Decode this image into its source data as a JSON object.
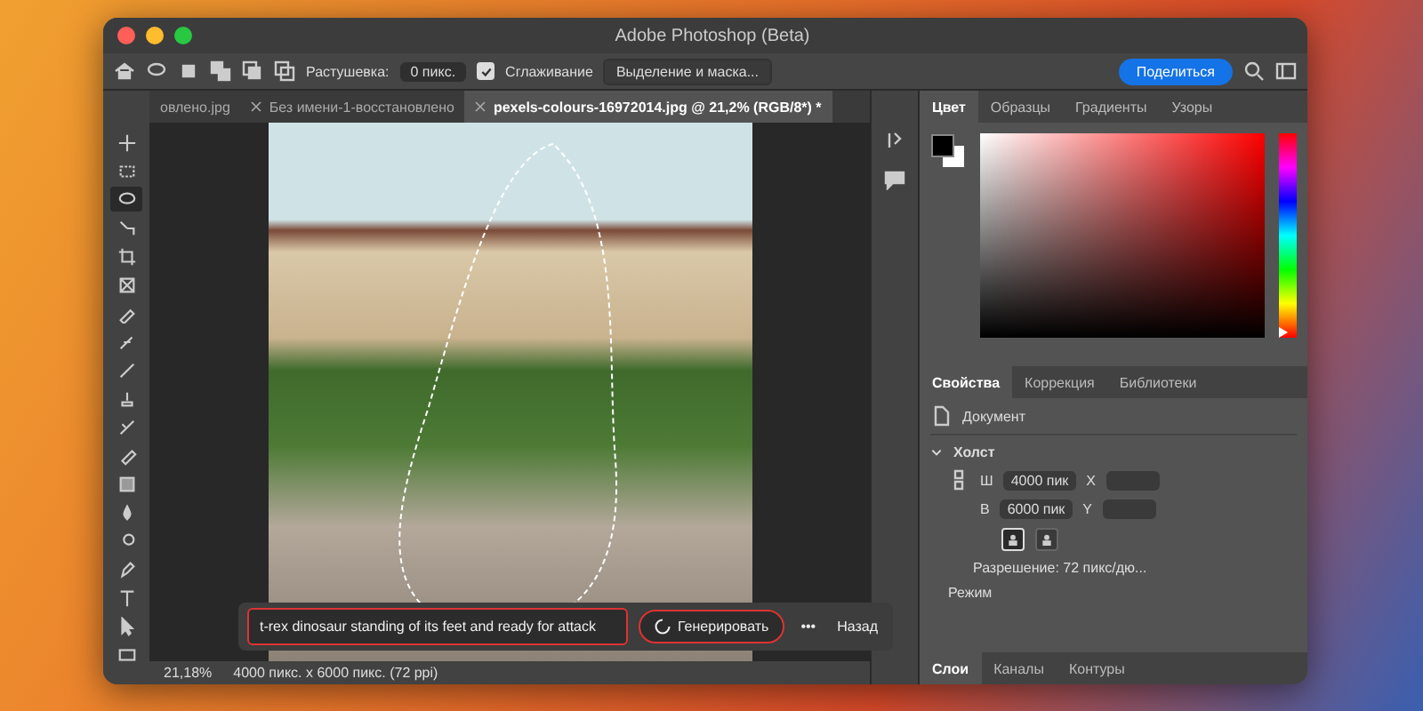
{
  "window": {
    "title": "Adobe Photoshop (Beta)"
  },
  "options_bar": {
    "feather_label": "Растушевка:",
    "feather_value": "0 пикс.",
    "antialias": {
      "label": "Сглаживание",
      "checked": true
    },
    "select_mask_button": "Выделение и маска...",
    "share_button": "Поделиться"
  },
  "doc_tabs": [
    {
      "label": "овлено.jpg",
      "selected": false
    },
    {
      "label": "Без имени-1-восстановлено",
      "selected": false
    },
    {
      "label": "pexels-colours-16972014.jpg @ 21,2% (RGB/8*) *",
      "selected": true
    }
  ],
  "tools": [
    {
      "selected": false
    },
    {
      "selected": false
    },
    {
      "selected": true
    },
    {
      "selected": false
    },
    {
      "selected": false
    },
    {
      "selected": false
    },
    {
      "selected": false
    },
    {
      "selected": false
    },
    {
      "selected": false
    },
    {
      "selected": false
    },
    {
      "selected": false
    },
    {
      "selected": false
    },
    {
      "selected": false
    },
    {
      "selected": false
    },
    {
      "selected": false
    },
    {
      "selected": false
    },
    {
      "selected": false
    },
    {
      "selected": false
    },
    {
      "selected": false
    }
  ],
  "generative_bar": {
    "prompt": "t-rex dinosaur standing of its feet and ready for attack",
    "generate_button": "Генерировать",
    "more_button": "•••",
    "back_button": "Назад"
  },
  "status_bar": {
    "zoom": "21,18%",
    "size": "4000 пикс. x 6000 пикс. (72 ppi)"
  },
  "color_panel": {
    "hue": {
      "level": 0
    },
    "tabs": [
      {
        "label": "Цвет",
        "selected": true
      },
      {
        "label": "Образцы",
        "selected": false
      },
      {
        "label": "Градиенты",
        "selected": false
      },
      {
        "label": "Узоры",
        "selected": false
      }
    ]
  },
  "properties_panel": {
    "tabs": [
      {
        "label": "Свойства",
        "selected": true
      },
      {
        "label": "Коррекция",
        "selected": false
      },
      {
        "label": "Библиотеки",
        "selected": false
      }
    ],
    "document_label": "Документ",
    "canvas": {
      "title": "Холст",
      "expanded": true,
      "width_label": "Ш",
      "width": "4000 пик",
      "x_label": "X",
      "height_label": "В",
      "height": "6000 пик",
      "y_label": "Y",
      "orientations": [
        {
          "selected": true
        },
        {
          "selected": false
        }
      ],
      "resolution": "Разрешение: 72 пикс/дю...",
      "mode": "Режим"
    }
  },
  "layers_panel": {
    "tabs": [
      {
        "label": "Слои",
        "selected": true
      },
      {
        "label": "Каналы",
        "selected": false
      },
      {
        "label": "Контуры",
        "selected": false
      }
    ]
  }
}
